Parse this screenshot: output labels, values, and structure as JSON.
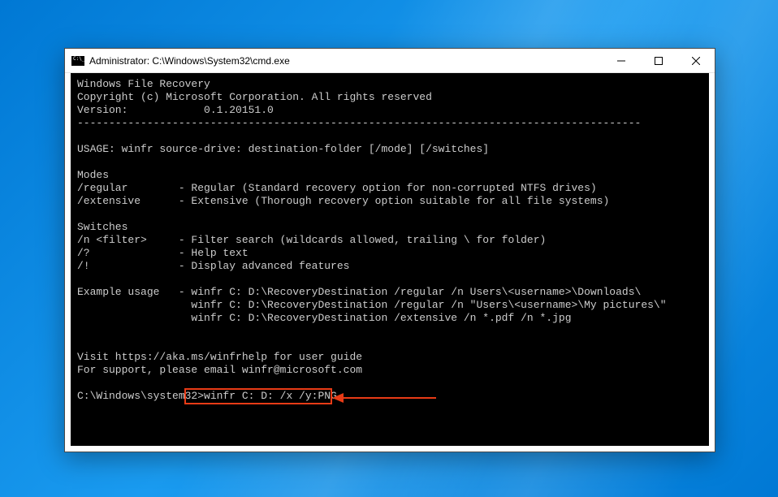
{
  "window": {
    "title": "Administrator: C:\\Windows\\System32\\cmd.exe"
  },
  "terminal": {
    "lines": [
      "Windows File Recovery",
      "Copyright (c) Microsoft Corporation. All rights reserved",
      "Version:            0.1.20151.0",
      "-----------------------------------------------------------------------------------------",
      "",
      "USAGE: winfr source-drive: destination-folder [/mode] [/switches]",
      "",
      "Modes",
      "/regular        - Regular (Standard recovery option for non-corrupted NTFS drives)",
      "/extensive      - Extensive (Thorough recovery option suitable for all file systems)",
      "",
      "Switches",
      "/n <filter>     - Filter search (wildcards allowed, trailing \\ for folder)",
      "/?              - Help text",
      "/!              - Display advanced features",
      "",
      "Example usage   - winfr C: D:\\RecoveryDestination /regular /n Users\\<username>\\Downloads\\",
      "                  winfr C: D:\\RecoveryDestination /regular /n \"Users\\<username>\\My pictures\\\"",
      "                  winfr C: D:\\RecoveryDestination /extensive /n *.pdf /n *.jpg",
      "",
      "",
      "Visit https://aka.ms/winfrhelp for user guide",
      "For support, please email winfr@microsoft.com",
      ""
    ],
    "prompt": "C:\\Windows\\system32>",
    "command": "winfr C: D: /x /y:PNG"
  }
}
